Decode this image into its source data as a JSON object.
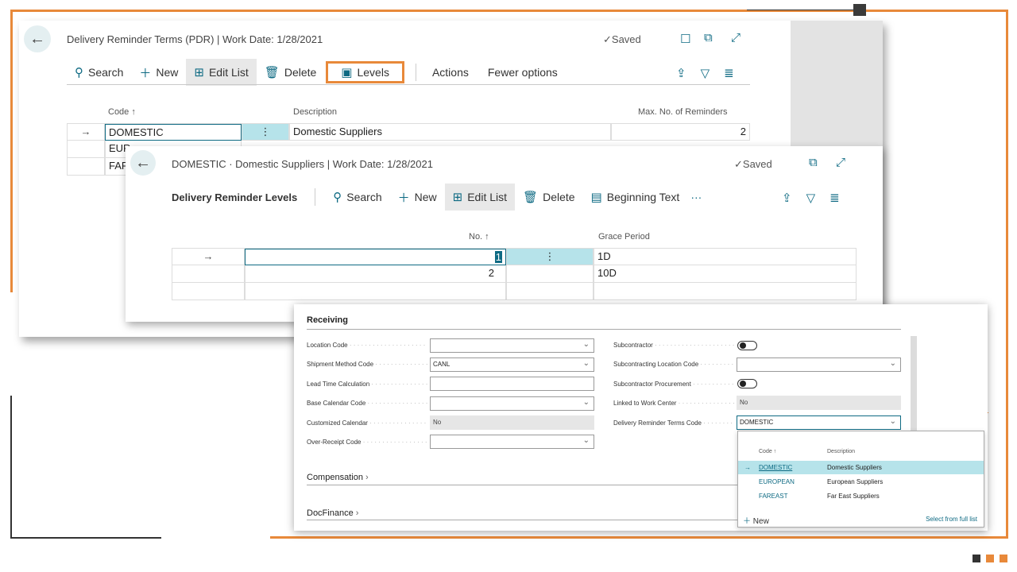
{
  "colors": {
    "accent": "#0e6a83",
    "orange": "#e8893a",
    "selected": "#b6e3ea"
  },
  "list_page": {
    "title": "Delivery Reminder Terms (PDR) | Work Date: 1/28/2021",
    "saved": "Saved",
    "toolbar": {
      "search": "Search",
      "new": "New",
      "edit_list": "Edit List",
      "delete": "Delete",
      "levels": "Levels",
      "actions": "Actions",
      "fewer_options": "Fewer options"
    },
    "columns": {
      "code": "Code ↑",
      "description": "Description",
      "max_reminders": "Max. No. of Reminders"
    },
    "rows": [
      {
        "code": "DOMESTIC",
        "description": "Domestic Suppliers",
        "max": "2"
      },
      {
        "code": "EUR",
        "description": "",
        "max": ""
      },
      {
        "code": "FAR",
        "description": "",
        "max": ""
      }
    ]
  },
  "levels_page": {
    "title": "DOMESTIC · Domestic Suppliers | Work Date: 1/28/2021",
    "saved": "Saved",
    "section": "Delivery Reminder Levels",
    "toolbar": {
      "search": "Search",
      "new": "New",
      "edit_list": "Edit List",
      "delete": "Delete",
      "beginning_text": "Beginning Text",
      "more": "···"
    },
    "columns": {
      "no": "No. ↑",
      "grace": "Grace Period"
    },
    "rows": [
      {
        "no": "1",
        "grace": "1D"
      },
      {
        "no": "2",
        "grace": "10D"
      }
    ]
  },
  "card": {
    "receiving": "Receiving",
    "compensation": "Compensation",
    "docfinance": "DocFinance",
    "fields_left": [
      {
        "label": "Location Code",
        "value": "",
        "type": "select"
      },
      {
        "label": "Shipment Method Code",
        "value": "CANL",
        "type": "select"
      },
      {
        "label": "Lead Time Calculation",
        "value": "",
        "type": "text"
      },
      {
        "label": "Base Calendar Code",
        "value": "",
        "type": "select"
      },
      {
        "label": "Customized Calendar",
        "value": "No",
        "type": "readonly"
      },
      {
        "label": "Over-Receipt Code",
        "value": "",
        "type": "select"
      }
    ],
    "fields_right": [
      {
        "label": "Subcontractor",
        "type": "toggle"
      },
      {
        "label": "Subcontracting Location Code",
        "value": "",
        "type": "select"
      },
      {
        "label": "Subcontractor Procurement",
        "type": "toggle"
      },
      {
        "label": "Linked to Work Center",
        "value": "No",
        "type": "readonly"
      },
      {
        "label": "Delivery Reminder Terms Code",
        "value": "DOMESTIC",
        "type": "select"
      }
    ],
    "lookup": {
      "col_code": "Code ↑",
      "col_desc": "Description",
      "rows": [
        {
          "code": "DOMESTIC",
          "desc": "Domestic Suppliers"
        },
        {
          "code": "EUROPEAN",
          "desc": "European Suppliers"
        },
        {
          "code": "FAREAST",
          "desc": "Far East Suppliers"
        }
      ],
      "new": "New",
      "select_full": "Select from full list"
    }
  }
}
